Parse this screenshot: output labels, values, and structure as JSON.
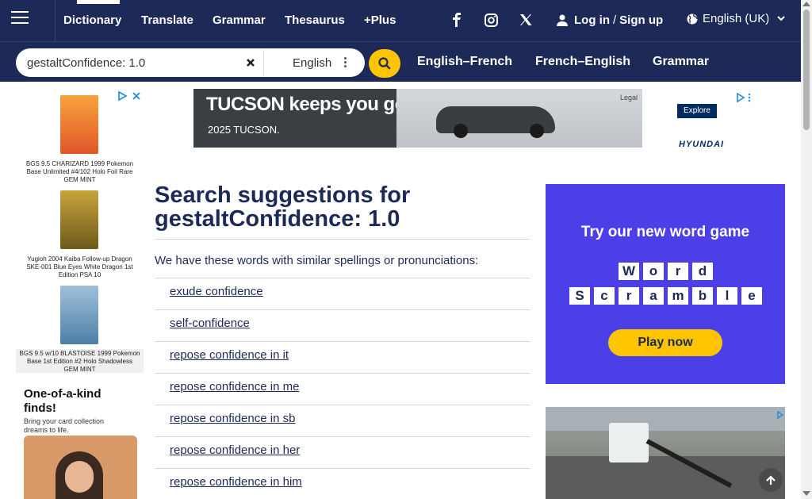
{
  "header": {
    "nav": [
      {
        "label": "Dictionary"
      },
      {
        "label": "Translate"
      },
      {
        "label": "Grammar"
      },
      {
        "label": "Thesaurus"
      },
      {
        "label": "+Plus"
      }
    ],
    "social_icons": [
      "facebook-icon",
      "instagram-icon",
      "x-twitter-icon"
    ],
    "login_label": "Log in",
    "separator": "/",
    "signup_label": "Sign up",
    "language_label": "English (UK)"
  },
  "search": {
    "value": "gestaltConfidence: 1.0",
    "dictionary_label": "English"
  },
  "dictionary_links": [
    {
      "label": "English–French"
    },
    {
      "label": "French–English"
    },
    {
      "label": "Grammar"
    }
  ],
  "main": {
    "title_prefix": "Search suggestions for",
    "title_term": "gestaltConfidence: 1.0",
    "intro": "We have these words with similar spellings or pronunciations:",
    "suggestions": [
      {
        "label": "exude confidence"
      },
      {
        "label": "self-confidence"
      },
      {
        "label": "repose confidence in it"
      },
      {
        "label": "repose confidence in me"
      },
      {
        "label": "repose confidence in sb"
      },
      {
        "label": "repose confidence in her"
      },
      {
        "label": "repose confidence in him"
      }
    ]
  },
  "ads": {
    "left": {
      "cards": [
        {
          "caption": "BGS 9.5 CHARIZARD 1999 Pokemon Base Unlimited #4/102 Holo Foil Rare GEM MINT"
        },
        {
          "caption": "Yugioh 2004 Kaiba Follow-up Dragon SKE-001 Blue Eyes White Dragon 1st Edition PSA 10"
        },
        {
          "caption": "BGS 9.5 w/10 BLASTOISE 1999 Pokemon Base 1st Edition #2 Holo Shadowless GEM MINT"
        }
      ],
      "promo_title": "One-of-a-kind finds!",
      "promo_sub": "Bring your card collection dreams to life."
    },
    "banner": {
      "headline": "TUCSON keeps you going.",
      "sub": "2025 TUCSON.",
      "legal": "Legal",
      "cta": "Explore",
      "brand": "HYUNDAI"
    },
    "word_game": {
      "title": "Try our new word game",
      "row1": [
        "W",
        "o",
        "r",
        "d"
      ],
      "row2": [
        "S",
        "c",
        "r",
        "a",
        "m",
        "b",
        "l",
        "e"
      ],
      "cta": "Play now"
    }
  },
  "colors": {
    "navy": "#1d2a57",
    "accent_yellow": "#fec400",
    "word_game_purple": "#4c3fe8"
  }
}
